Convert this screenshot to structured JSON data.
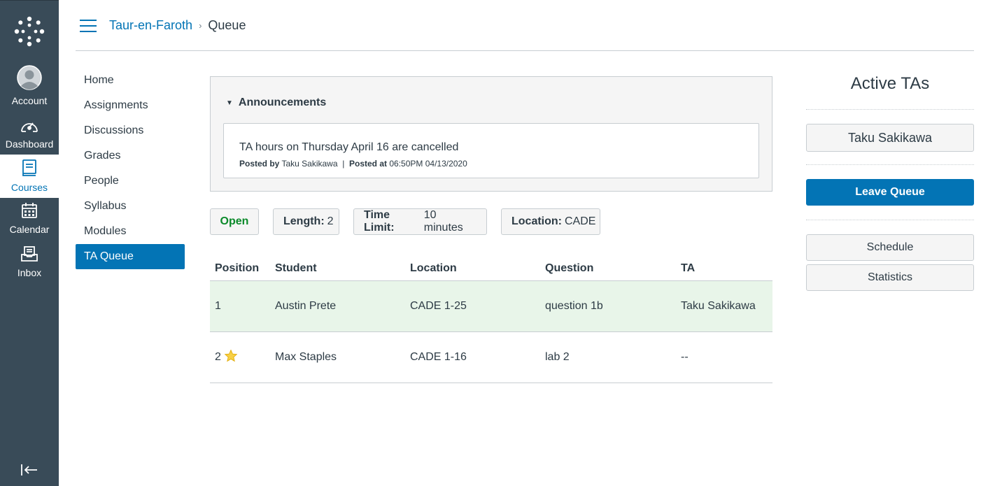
{
  "global_nav": {
    "items": [
      {
        "label": "Account",
        "icon": "account-avatar-icon"
      },
      {
        "label": "Dashboard",
        "icon": "dashboard-icon"
      },
      {
        "label": "Courses",
        "icon": "courses-icon",
        "active": true
      },
      {
        "label": "Calendar",
        "icon": "calendar-icon"
      },
      {
        "label": "Inbox",
        "icon": "inbox-icon"
      }
    ]
  },
  "breadcrumb": {
    "course": "Taur-en-Faroth",
    "separator": "›",
    "current": "Queue"
  },
  "course_nav": {
    "items": [
      "Home",
      "Assignments",
      "Discussions",
      "Grades",
      "People",
      "Syllabus",
      "Modules",
      "TA Queue"
    ],
    "active": "TA Queue"
  },
  "announcements": {
    "heading": "Announcements",
    "items": [
      {
        "title": "TA hours on Thursday April 16 are cancelled",
        "posted_by_label": "Posted by",
        "posted_by": "Taku Sakikawa",
        "divider": "|",
        "posted_at_label": "Posted at",
        "posted_at": "06:50PM 04/13/2020"
      }
    ]
  },
  "status": {
    "state": "Open",
    "length_label": "Length:",
    "length": "2",
    "time_limit_label": "Time Limit:",
    "time_limit": "10 minutes",
    "location_label": "Location:",
    "location": "CADE"
  },
  "queue_table": {
    "columns": [
      "Position",
      "Student",
      "Location",
      "Question",
      "TA"
    ],
    "rows": [
      {
        "position": "1",
        "student": "Austin Prete",
        "location": "CADE 1-25",
        "question": "question 1b",
        "ta": "Taku Sakikawa",
        "highlighted": true,
        "starred": false
      },
      {
        "position": "2",
        "student": "Max Staples",
        "location": "CADE 1-16",
        "question": "lab 2",
        "ta": "--",
        "highlighted": false,
        "starred": true
      }
    ]
  },
  "right_panel": {
    "title": "Active TAs",
    "active_tas": [
      "Taku Sakikawa"
    ],
    "leave_label": "Leave Queue",
    "schedule_label": "Schedule",
    "statistics_label": "Statistics"
  },
  "colors": {
    "nav_bg": "#394b58",
    "brand_blue": "#0374b5",
    "open_green": "#0b8a2a",
    "highlight_row": "#e8f5e9",
    "star": "#f2c200"
  }
}
